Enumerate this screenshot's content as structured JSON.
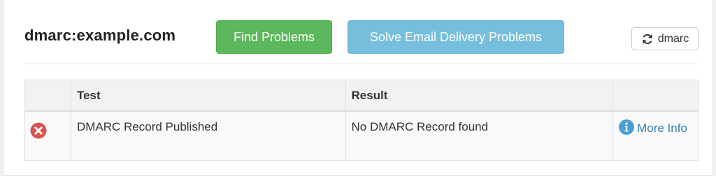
{
  "header": {
    "title": "dmarc:example.com",
    "find_problems_label": "Find Problems",
    "solve_label": "Solve Email Delivery Problems",
    "refresh_label": "dmarc"
  },
  "table": {
    "columns": [
      "",
      "Test",
      "Result",
      ""
    ],
    "rows": [
      {
        "status_icon": "error-x-icon",
        "test": "DMARC Record Published",
        "result": "No DMARC Record found",
        "info_link": "More Info"
      }
    ]
  },
  "colors": {
    "find_button": "#5cb85c",
    "solve_button": "#76bfdc",
    "error_icon": "#d9534f",
    "info_icon": "#4a9ed6",
    "link": "#337ab7"
  },
  "icons": {
    "refresh": "refresh-icon",
    "status": "error-x-icon",
    "info": "info-icon"
  }
}
